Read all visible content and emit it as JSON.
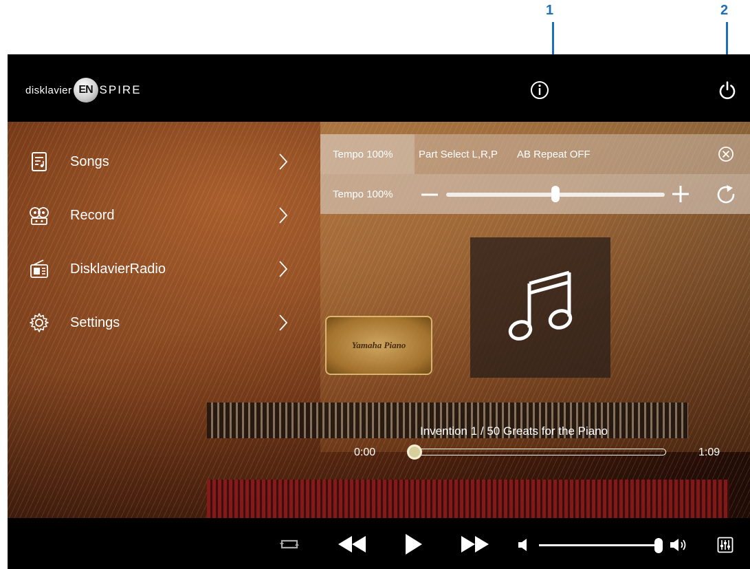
{
  "callouts": [
    "1",
    "2"
  ],
  "header": {
    "logo_prefix": "disklavier",
    "logo_badge": "EN",
    "logo_suffix": "SPIRE",
    "info_icon": "info-icon",
    "power_icon": "power-icon"
  },
  "menu": [
    {
      "label": "Songs",
      "icon": "songs-icon"
    },
    {
      "label": "Record",
      "icon": "record-reels-icon"
    },
    {
      "label": "DisklavierRadio",
      "icon": "radio-icon"
    },
    {
      "label": "Settings",
      "icon": "gear-icon"
    }
  ],
  "panel": {
    "tabs": [
      "Tempo 100%",
      "Part Select L,R,P",
      "AB Repeat OFF"
    ],
    "tempo_label": "Tempo 100%",
    "tempo_slider_fraction": 0.5
  },
  "background_text": "Yamaha Piano",
  "player": {
    "song_title": "Invention 1 / 50 Greats for the Piano",
    "elapsed": "0:00",
    "duration": "1:09",
    "progress_fraction": 0.0,
    "volume_fraction": 1.0
  },
  "colors": {
    "callout": "#1e6fb8",
    "topbar": "#000000",
    "progress_thumb": "#d8cf9a"
  }
}
